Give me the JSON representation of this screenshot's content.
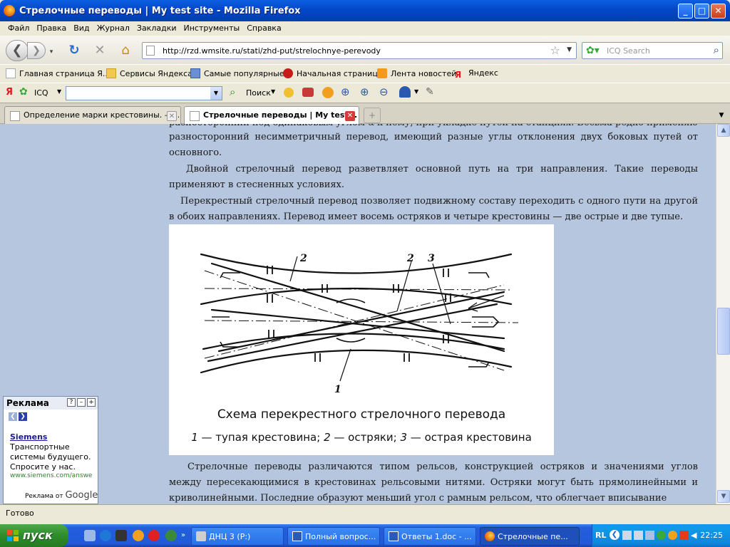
{
  "window": {
    "title": "Стрелочные переводы | My test site - Mozilla Firefox",
    "minimize": "_",
    "maximize": "□",
    "close": "✕"
  },
  "menu": [
    "Файл",
    "Правка",
    "Вид",
    "Журнал",
    "Закладки",
    "Инструменты",
    "Справка"
  ],
  "navigation": {
    "url": "http://rzd.wmsite.ru/stati/zhd-put/strelochnye-perevody",
    "search_placeholder": "ICQ Search"
  },
  "bookmarks": [
    "Главная страница Я...",
    "Сервисы Яндекса",
    "Самые популярные",
    "Начальная страница",
    "Лента новостей",
    "Яндекс"
  ],
  "toolbar": {
    "yandex_label": "Я",
    "icq_label": "ICQ",
    "search_button": "Поиск"
  },
  "tabs": [
    {
      "label": "Определение марки крестовины. — ...",
      "active": false
    },
    {
      "label": "Стрелочные переводы | My test...",
      "active": true
    }
  ],
  "article": {
    "para_top_cut": "разносторонний под одинаковым углом α к нему, при укладке путей на станциях. Весьма редко применяют",
    "para_top_line2": "разносторонний несимметричный перевод, имеющий разные углы отклонения двух боковых путей от",
    "para_top_line3": "основного.",
    "para_double": "Двойной стрелочный перевод разветвляет основной путь на три направления. Такие переводы применяют в стесненных условиях.",
    "para_cross": "Перекрестный стрелочный перевод позволяет подвижному составу переходить с одного пути на другой в обоих направлениях. Перевод имеет восемь остряков и четыре крестовины — две острые и две тупые.",
    "para_bottom": "Стрелочные переводы различаются типом рельсов, конструкцией остряков и значениями углов между пересекающимися в крестовинах рельсовыми нитями. Остряки могут быть прямолинейными и криволинейными. Последние образуют меньший угол с рамным рельсом, что облегчает вписывание"
  },
  "figure": {
    "caption_title": "Схема перекрестного стрелочного перевода",
    "legend_1_num": "1",
    "legend_1_text": " — тупая крестовина; ",
    "legend_2_num": "2",
    "legend_2_text": " — остряки; ",
    "legend_3_num": "3",
    "legend_3_text": " — острая крестовина",
    "label_1": "1",
    "label_2a": "2",
    "label_2b": "2",
    "label_3": "3"
  },
  "ad": {
    "header": "Реклама",
    "brand": "Siemens",
    "line1": "Транспортные",
    "line2": "системы будущего.",
    "line3": "Спросите у нас.",
    "url": "www.siemens.com/answe",
    "footer_prefix": "Реклама от",
    "footer_brand": "Google"
  },
  "status": "Готово",
  "taskbar": {
    "start": "пуск",
    "tasks": [
      "ДНЦ 3 (P:)",
      "Полный вопрос...",
      "Ответы 1.doc - ...",
      "Стрелочные пе..."
    ],
    "lang": "RL",
    "clock": "22:25"
  }
}
